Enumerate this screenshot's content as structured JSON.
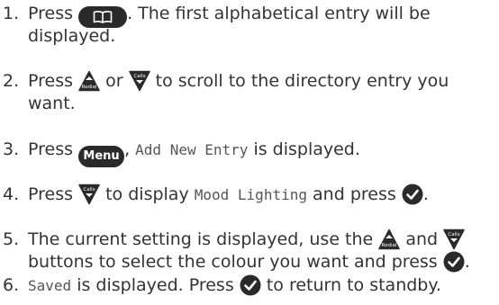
{
  "steps": [
    {
      "num": "1.",
      "line1_a": "Press",
      "line1_b": ". The first alphabetical entry will be",
      "line2": "displayed.",
      "phonebook_icon": "phonebook-button-icon"
    },
    {
      "num": "2.",
      "line1_a": "Press",
      "line1_b": "or",
      "line1_c": "to scroll to the directory entry you",
      "line2": "want.",
      "redial_label": "Redial",
      "calls_label": "Calls"
    },
    {
      "num": "3.",
      "line1_a": "Press",
      "menu_label": "Menu",
      "line1_b": ",",
      "lcd": "Add New Entry",
      "line1_c": "is displayed."
    },
    {
      "num": "4.",
      "line1_a": "Press",
      "line1_b": "to display",
      "lcd": "Mood Lighting",
      "line1_c": "and press",
      "line1_d": ".",
      "calls_label": "Calls"
    },
    {
      "num": "5.",
      "line1_a": "The current setting is displayed, use the",
      "line1_b": "and",
      "line2_a": "buttons to select the colour you want and press",
      "line2_b": ".",
      "redial_label": "Redial",
      "calls_label": "Calls"
    },
    {
      "num": "6.",
      "lcd": "Saved",
      "line1_a": "is displayed. Press",
      "line1_b": "to return to standby."
    }
  ],
  "colors": {
    "text": "#333333",
    "button": "#2a2a2a",
    "button_text": "#ffffff"
  }
}
